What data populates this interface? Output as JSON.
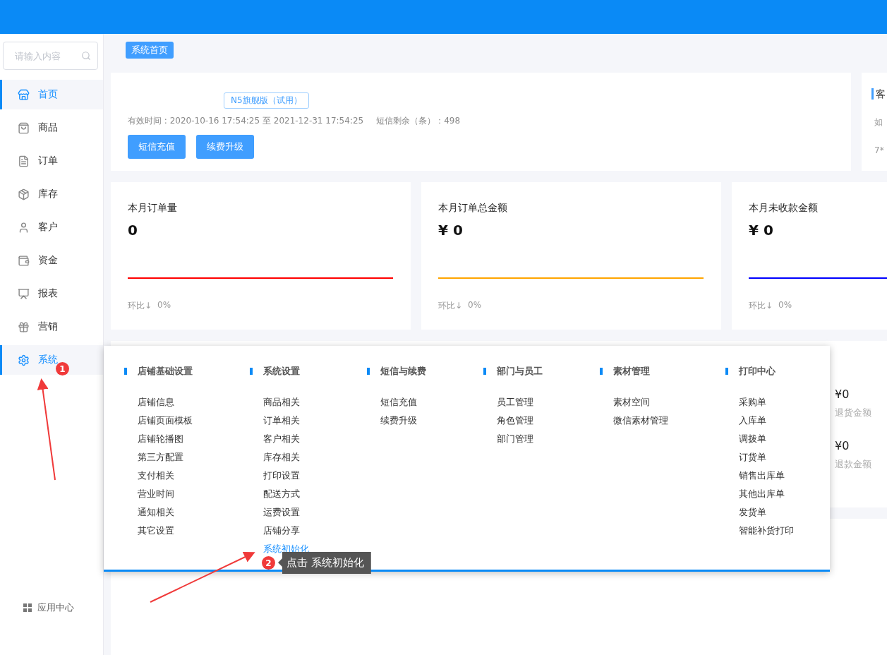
{
  "search": {
    "placeholder": "请输入内容"
  },
  "nav": [
    {
      "label": "首页",
      "selected": true
    },
    {
      "label": "商品",
      "selected": false
    },
    {
      "label": "订单",
      "selected": false
    },
    {
      "label": "库存",
      "selected": false
    },
    {
      "label": "客户",
      "selected": false
    },
    {
      "label": "资金",
      "selected": false
    },
    {
      "label": "报表",
      "selected": false
    },
    {
      "label": "营销",
      "selected": false
    },
    {
      "label": "系统",
      "selected": true
    }
  ],
  "app_center": "应用中心",
  "breadcrumb": "系统首页",
  "account": {
    "edition": "N5旗舰版（试用）",
    "validity": "有效时间 : 2020-10-16 17:54:25 至 2021-12-31 17:54:25",
    "sms_remaining": "短信剩余（条）：498",
    "buttons": [
      "短信充值",
      "续费升级"
    ]
  },
  "service_card": {
    "title": "客",
    "lines": [
      "如",
      "7*"
    ]
  },
  "stats": [
    {
      "title": "本月订单量",
      "value": "0",
      "color": "#ff0000",
      "compare": "环比↓",
      "change": "0%"
    },
    {
      "title": "本月订单总金额",
      "value": "¥ 0",
      "color": "#ffa500",
      "compare": "环比↓",
      "change": "0%"
    },
    {
      "title": "本月未收款金额",
      "value": "¥ 0",
      "color": "#0000ff",
      "compare": "环比↓",
      "change": "0%"
    }
  ],
  "refunds": [
    {
      "value": "¥0",
      "label": "退货金额"
    },
    {
      "value": "¥0",
      "label": "退款金额"
    }
  ],
  "menu": {
    "columns": [
      {
        "title": "店铺基础设置",
        "items": [
          {
            "label": "店铺信息",
            "selected": false
          },
          {
            "label": "店铺页面模板",
            "selected": false
          },
          {
            "label": "店铺轮播图",
            "selected": false
          },
          {
            "label": "第三方配置",
            "selected": false
          },
          {
            "label": "支付相关",
            "selected": false
          },
          {
            "label": "营业时间",
            "selected": false
          },
          {
            "label": "通知相关",
            "selected": false
          },
          {
            "label": "其它设置",
            "selected": false
          }
        ]
      },
      {
        "title": "系统设置",
        "items": [
          {
            "label": "商品相关",
            "selected": false
          },
          {
            "label": "订单相关",
            "selected": false
          },
          {
            "label": "客户相关",
            "selected": false
          },
          {
            "label": "库存相关",
            "selected": false
          },
          {
            "label": "打印设置",
            "selected": false
          },
          {
            "label": "配送方式",
            "selected": false
          },
          {
            "label": "运费设置",
            "selected": false
          },
          {
            "label": "店铺分享",
            "selected": false
          },
          {
            "label": "系统初始化",
            "selected": true
          }
        ]
      },
      {
        "title": "短信与续费",
        "items": [
          {
            "label": "短信充值",
            "selected": false
          },
          {
            "label": "续费升级",
            "selected": false
          }
        ]
      },
      {
        "title": "部门与员工",
        "items": [
          {
            "label": "员工管理",
            "selected": false
          },
          {
            "label": "角色管理",
            "selected": false
          },
          {
            "label": "部门管理",
            "selected": false
          }
        ]
      },
      {
        "title": "素材管理",
        "items": [
          {
            "label": "素材空间",
            "selected": false
          },
          {
            "label": "微信素材管理",
            "selected": false
          }
        ]
      },
      {
        "title": "打印中心",
        "items": [
          {
            "label": "采购单",
            "selected": false
          },
          {
            "label": "入库单",
            "selected": false
          },
          {
            "label": "调拨单",
            "selected": false
          },
          {
            "label": "订货单",
            "selected": false
          },
          {
            "label": "销售出库单",
            "selected": false
          },
          {
            "label": "其他出库单",
            "selected": false
          },
          {
            "label": "发货单",
            "selected": false
          },
          {
            "label": "智能补货打印",
            "selected": false
          }
        ]
      }
    ]
  },
  "annotations": [
    {
      "number": "1"
    },
    {
      "number": "2",
      "tip": "点击 系统初始化"
    }
  ]
}
